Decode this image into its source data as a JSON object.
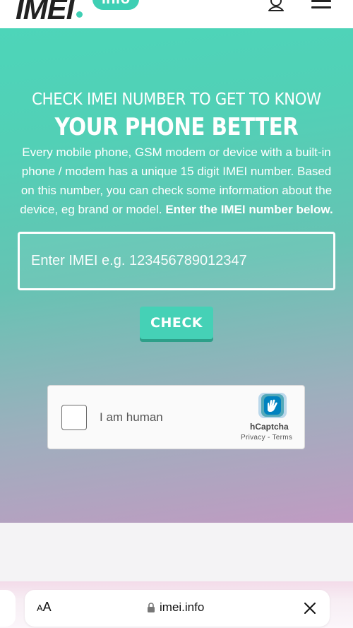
{
  "header": {
    "logo_text": "IMEI",
    "logo_badge": "info",
    "icons": [
      "user-icon",
      "hamburger-menu-icon"
    ]
  },
  "hero": {
    "kicker": "CHECK IMEI NUMBER TO GET TO KNOW",
    "headline": "YOUR PHONE BETTER",
    "description": "Every mobile phone, GSM modem or device with a built-in phone / modem has a unique 15 digit IMEI number. Based on this number, you can check some information about the device, eg brand or model.",
    "description_emphasis": "Enter the IMEI number below.",
    "imei_input": {
      "value": "",
      "placeholder": "Enter IMEI e.g. 123456789012347"
    },
    "check_button_label": "CHECK"
  },
  "captcha": {
    "checkbox_label": "I am human",
    "brand": "hCaptcha",
    "privacy_link": "Privacy",
    "separator": " - ",
    "terms_link": "Terms"
  },
  "browser": {
    "text_size_small": "A",
    "text_size_big": "A",
    "url": "imei.info",
    "icons": [
      "lock-icon",
      "close-icon"
    ]
  },
  "colors": {
    "brand_teal": "#3fcfb4",
    "gradient_top": "#4dd5b9",
    "gradient_bottom": "#c09bc2",
    "button_shadow": "#2d9f89"
  }
}
